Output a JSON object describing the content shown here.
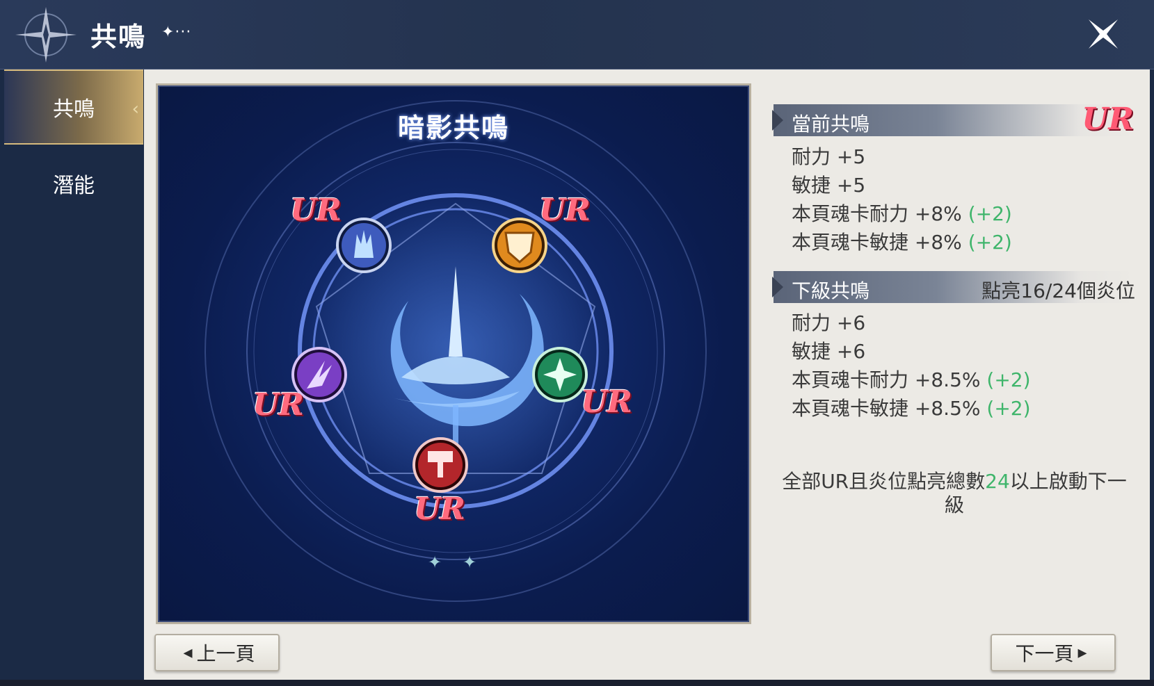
{
  "header": {
    "title": "共鳴",
    "title_ornament": "✦···"
  },
  "sidebar": {
    "tabs": [
      {
        "label": "共鳴",
        "active": true
      },
      {
        "label": "潛能",
        "active": false
      }
    ]
  },
  "resonance": {
    "name": "暗影共鳴",
    "slots": [
      {
        "rarity": "UR",
        "icon": "blue-hand-icon",
        "color": "#3e5bbd"
      },
      {
        "rarity": "UR",
        "icon": "orange-shield-icon",
        "color": "#e08a1e"
      },
      {
        "rarity": "UR",
        "icon": "purple-claw-icon",
        "color": "#7a3fc4"
      },
      {
        "rarity": "UR",
        "icon": "green-cross-icon",
        "color": "#1f8a5a"
      },
      {
        "rarity": "UR",
        "icon": "red-hammer-icon",
        "color": "#b3262b"
      }
    ],
    "center_icon": "water-moon-icon",
    "page_dots": [
      "✦",
      "✦"
    ]
  },
  "current": {
    "title": "當前共鳴",
    "badge": "UR",
    "stats": [
      {
        "text": "耐力 +5",
        "bonus": ""
      },
      {
        "text": "敏捷 +5",
        "bonus": ""
      },
      {
        "text": "本頁魂卡耐力 +8% ",
        "bonus": "(+2)"
      },
      {
        "text": "本頁魂卡敏捷 +8% ",
        "bonus": "(+2)"
      }
    ]
  },
  "next": {
    "title": "下級共鳴",
    "progress": "點亮16/24個炎位",
    "stats": [
      {
        "text": "耐力 +6",
        "bonus": ""
      },
      {
        "text": "敏捷 +6",
        "bonus": ""
      },
      {
        "text": "本頁魂卡耐力 +8.5% ",
        "bonus": "(+2)"
      },
      {
        "text": "本頁魂卡敏捷 +8.5% ",
        "bonus": "(+2)"
      }
    ]
  },
  "requirement": {
    "prefix": "全部UR且炎位點亮總數",
    "number": "24",
    "suffix": "以上啟動下一級"
  },
  "nav": {
    "prev_label": "上一頁",
    "next_label": "下一頁"
  },
  "colors": {
    "accent_green": "#3fb56b",
    "ur_red": "#ff5a74",
    "header_bg": "#2a3a5a"
  }
}
